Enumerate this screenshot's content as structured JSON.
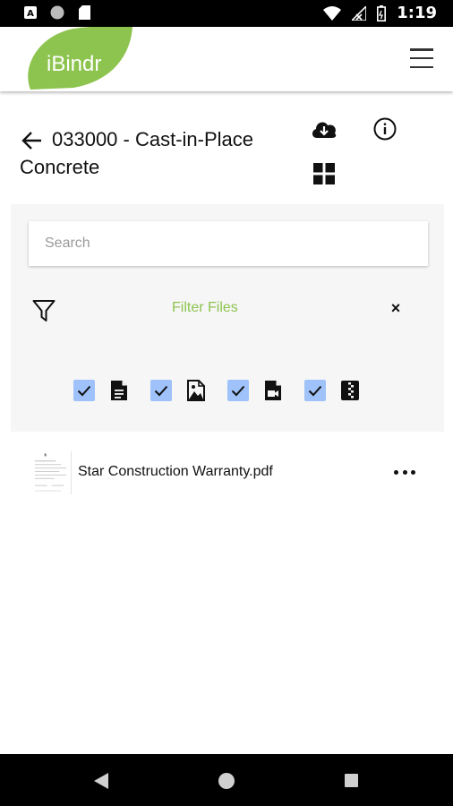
{
  "status_bar": {
    "time": "1:19",
    "icons": [
      "a-notification-icon",
      "circle-notification-icon",
      "sd-card-icon",
      "wifi-icon",
      "no-signal-icon",
      "battery-icon"
    ]
  },
  "header": {
    "logo_text": "iBindr",
    "brand_color": "#8dc44f",
    "menu_icon": "hamburger-menu-icon"
  },
  "page": {
    "title": "033000 - Cast-in-Place Concrete",
    "actions": [
      "back-arrow-icon",
      "cloud-download-icon",
      "info-icon",
      "grid-view-icon"
    ]
  },
  "filter": {
    "search_placeholder": "Search",
    "label": "Filter Files",
    "clear_symbol": "×",
    "accent_color": "#8dc44f",
    "file_types": [
      {
        "icon": "document-icon",
        "checked": true
      },
      {
        "icon": "image-file-icon",
        "checked": true
      },
      {
        "icon": "video-file-icon",
        "checked": true
      },
      {
        "icon": "zip-file-icon",
        "checked": true
      }
    ]
  },
  "files": [
    {
      "name": "Star Construction Warranty.pdf",
      "menu_icon": "more-options-icon"
    }
  ],
  "nav_bar": {
    "icons": [
      "nav-back-icon",
      "nav-home-icon",
      "nav-recents-icon"
    ]
  }
}
